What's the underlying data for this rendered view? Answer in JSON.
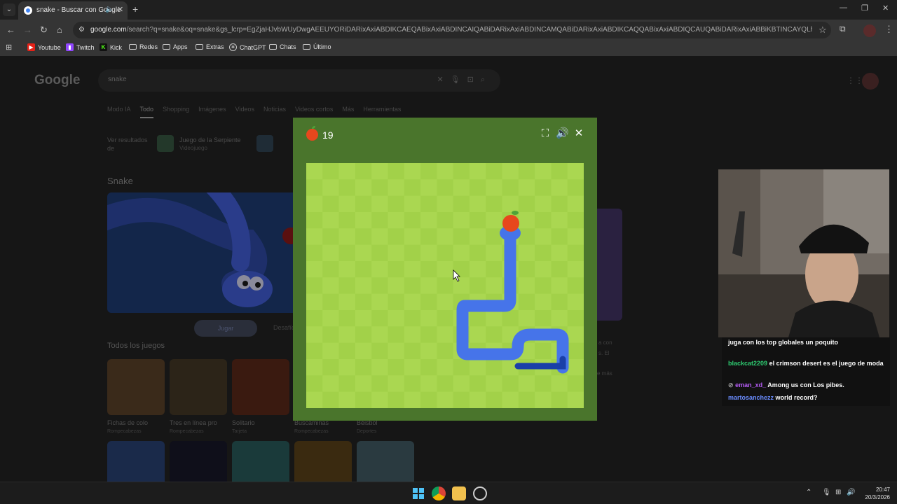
{
  "browser": {
    "tab_title": "snake - Buscar con Google",
    "url_host": "google.com",
    "url_rest": "/search?q=snake&oq=snake&gs_lcrp=EgZjaHJvbWUyDwgAEEUYORiDARixAxiABDIKCAEQABixAxiABDINCAIQABiDARixAxiABDINCAMQABiDARixAxiABDIKCAQQABixAxiABDIQCAUQABiDARixAxiABBiKBTINCAYQLhiDARixAxiABDIQCAcQLhjH...",
    "bookmarks": [
      "Youtube",
      "Twitch",
      "Kick",
      "Redes",
      "Apps",
      "Extras",
      "ChatGPT",
      "Chats",
      "Último"
    ]
  },
  "google": {
    "logo": "Google",
    "query": "snake",
    "tabs": [
      "Modo IA",
      "Todo",
      "Shopping",
      "Imágenes",
      "Videos",
      "Noticias",
      "Videos cortos",
      "Más",
      "Herramientas"
    ],
    "active_tab": "Todo",
    "see_results_label": "Ver resultados de",
    "chip_title": "Juego de la Serpiente",
    "chip_sub": "Videojuego",
    "section_title": "Snake",
    "play_label": "Jugar",
    "challenge_label": "Desafío",
    "all_games_label": "Todos los juegos",
    "games": [
      {
        "title": "Fichas de colo",
        "sub": "Rompecabezas"
      },
      {
        "title": "Tres en línea pro",
        "sub": "Rompecabezas"
      },
      {
        "title": "Solitario",
        "sub": "Tarjeta"
      },
      {
        "title": "Buscaminas",
        "sub": "Rompecabezas"
      },
      {
        "title": "Béisbol",
        "sub": "Deportes"
      }
    ],
    "side_text": [
      "a con",
      "s. El",
      "ve más"
    ]
  },
  "game": {
    "score": "19",
    "colors": {
      "board_light": "#aad751",
      "board_dark": "#a2d149",
      "frame": "#4a752c",
      "snake": "#4674e9",
      "apple": "#e7471d"
    }
  },
  "chat": [
    {
      "user": "",
      "message": "juga con los top globales un poquito",
      "color": "#8a5cf6"
    },
    {
      "user": "blackcat2209",
      "message": "el crimson desert es el juego de moda",
      "color": "#2ecc71"
    },
    {
      "user": "eman_xd_",
      "message": "Among us con Los pibes.",
      "color": "#b65cf6"
    },
    {
      "user": "martosanchezz",
      "message": "world record?",
      "color": "#6a8cff"
    }
  ],
  "taskbar": {
    "time": "20:47",
    "date": "20/3/2026"
  }
}
